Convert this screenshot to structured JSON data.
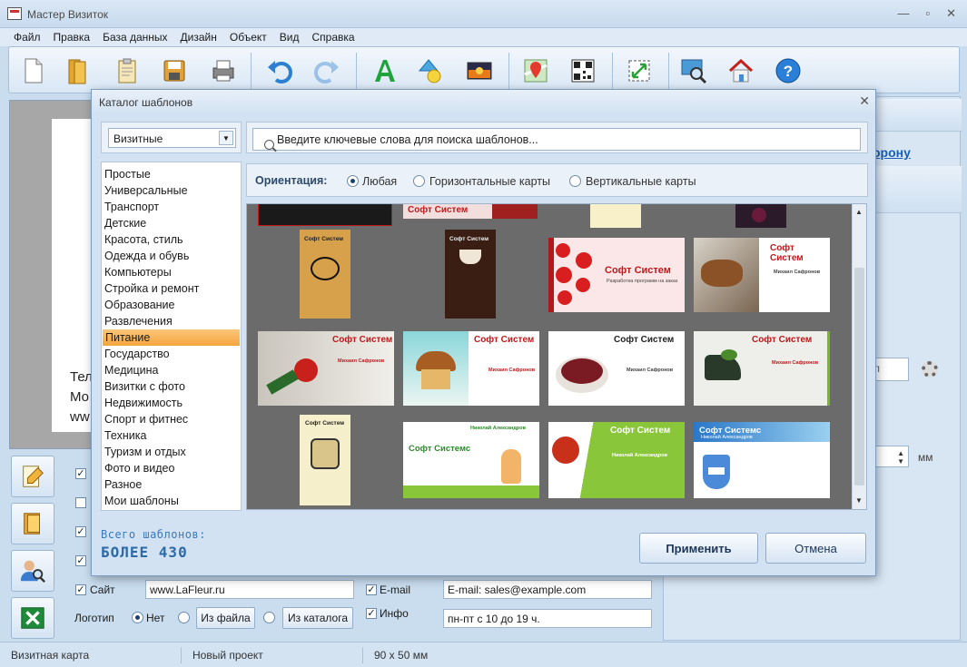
{
  "window": {
    "title": "Мастер Визиток",
    "controls": [
      "—",
      "▫",
      "✕"
    ]
  },
  "menu": [
    "Файл",
    "Правка",
    "База данных",
    "Дизайн",
    "Объект",
    "Вид",
    "Справка"
  ],
  "toolbar": {
    "icons": [
      "new-document-icon",
      "open-folder-icon",
      "clipboard-icon",
      "save-icon",
      "print-icon",
      "undo-icon",
      "redo-icon",
      "text-icon",
      "shapes-icon",
      "image-icon",
      "map-icon",
      "qr-code-icon",
      "fit-icon",
      "preview-icon",
      "home-icon",
      "help-icon"
    ]
  },
  "preview": {
    "line1": "Тел",
    "line2": "Мо",
    "line3": "ww"
  },
  "right_panel": {
    "link": "орону",
    "field_label": "л",
    "unit": "мм"
  },
  "form": {
    "site_label": "Сайт",
    "site_value": "www.LaFleur.ru",
    "email_label": "E-mail",
    "email_value": "E-mail: sales@example.com",
    "info_label": "Инфо",
    "info_value": "пн-пт с 10 до 19 ч.",
    "logo_label": "Логотип",
    "logo_none": "Нет",
    "from_file": "Из файла",
    "from_catalog": "Из каталога"
  },
  "status": {
    "type": "Визитная карта",
    "project": "Новый проект",
    "size": "90 x 50 мм"
  },
  "dialog": {
    "title": "Каталог шаблонов",
    "close": "✕",
    "category_select": "Визитные",
    "search_placeholder": "Введите ключевые слова для поиска шаблонов...",
    "orientation_label": "Ориентация:",
    "orientation_options": [
      "Любая",
      "Горизонтальные карты",
      "Вертикальные карты"
    ],
    "categories": [
      "Простые",
      "Универсальные",
      "Транспорт",
      "Детские",
      "Красота, стиль",
      "Одежда и обувь",
      "Компьютеры",
      "Стройка и ремонт",
      "Образование",
      "Развлечения",
      "Питание",
      "Государство",
      "Медицина",
      "Визитки с фото",
      "Недвижимость",
      "Спорт и фитнес",
      "Техника",
      "Туризм и отдых",
      "Фото и видео",
      "Разное",
      "Мои шаблоны"
    ],
    "selected_category": "Питание",
    "total_label": "Всего шаблонов:",
    "total_value": "БОЛЕЕ 430",
    "apply": "Применить",
    "cancel": "Отмена"
  },
  "templates": {
    "soft_system": "Софт Систем",
    "soft_systems": "Софт Системс",
    "person1": "Михаил Сафронов",
    "person2": "Николай Александров",
    "tagline": "Разработка программ на заказ"
  }
}
